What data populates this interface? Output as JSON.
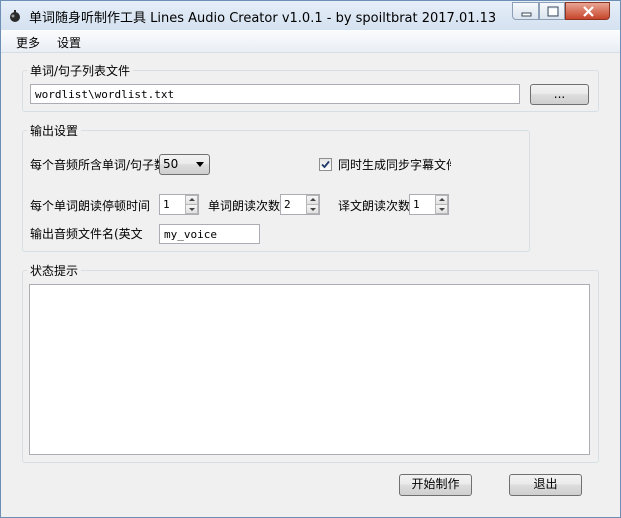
{
  "window": {
    "title": "单词随身听制作工具  Lines Audio Creator v1.0.1 - by spoiltbrat  2017.01.13"
  },
  "menu": {
    "items": [
      "更多",
      "设置"
    ]
  },
  "wordlist_group": {
    "title": "单词/句子列表文件",
    "path_value": "wordlist\\wordlist.txt",
    "browse_label": "..."
  },
  "output_group": {
    "title": "输出设置",
    "words_per_file_label": "每个音频所含单词/句子数",
    "words_per_file_value": "50",
    "subtitle_checkbox_label": "同时生成同步字幕文件",
    "subtitle_checked": true,
    "pause_label": "每个单词朗读停顿时间（s",
    "pause_value": "1",
    "word_repeat_label": "单词朗读次数",
    "word_repeat_value": "2",
    "trans_repeat_label": "译文朗读次数",
    "trans_repeat_value": "1",
    "filename_label": "输出音频文件名(英文",
    "filename_value": "my_voice"
  },
  "status_group": {
    "title": "状态提示",
    "text": ""
  },
  "actions": {
    "start_label": "开始制作",
    "exit_label": "退出"
  }
}
